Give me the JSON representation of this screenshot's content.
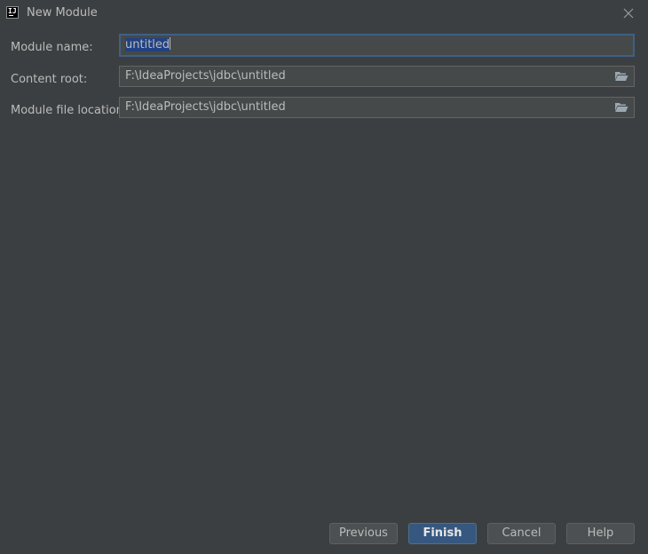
{
  "window": {
    "title": "New Module",
    "app_icon_text": "IJ"
  },
  "form": {
    "module_name": {
      "label": "Module name:",
      "value": "untitled"
    },
    "content_root": {
      "label": "Content root:",
      "value": "F:\\IdeaProjects\\jdbc\\untitled",
      "browse_icon": "folder-open-icon"
    },
    "module_file_location": {
      "label": "Module file location:",
      "value": "F:\\IdeaProjects\\jdbc\\untitled",
      "browse_icon": "folder-open-icon"
    }
  },
  "buttons": {
    "previous": "Previous",
    "finish": "Finish",
    "cancel": "Cancel",
    "help": "Help"
  },
  "colors": {
    "background": "#3c3f41",
    "input_background": "#45494a",
    "selection": "#214283",
    "focus_border": "#3d6185",
    "default_button": "#365880"
  }
}
